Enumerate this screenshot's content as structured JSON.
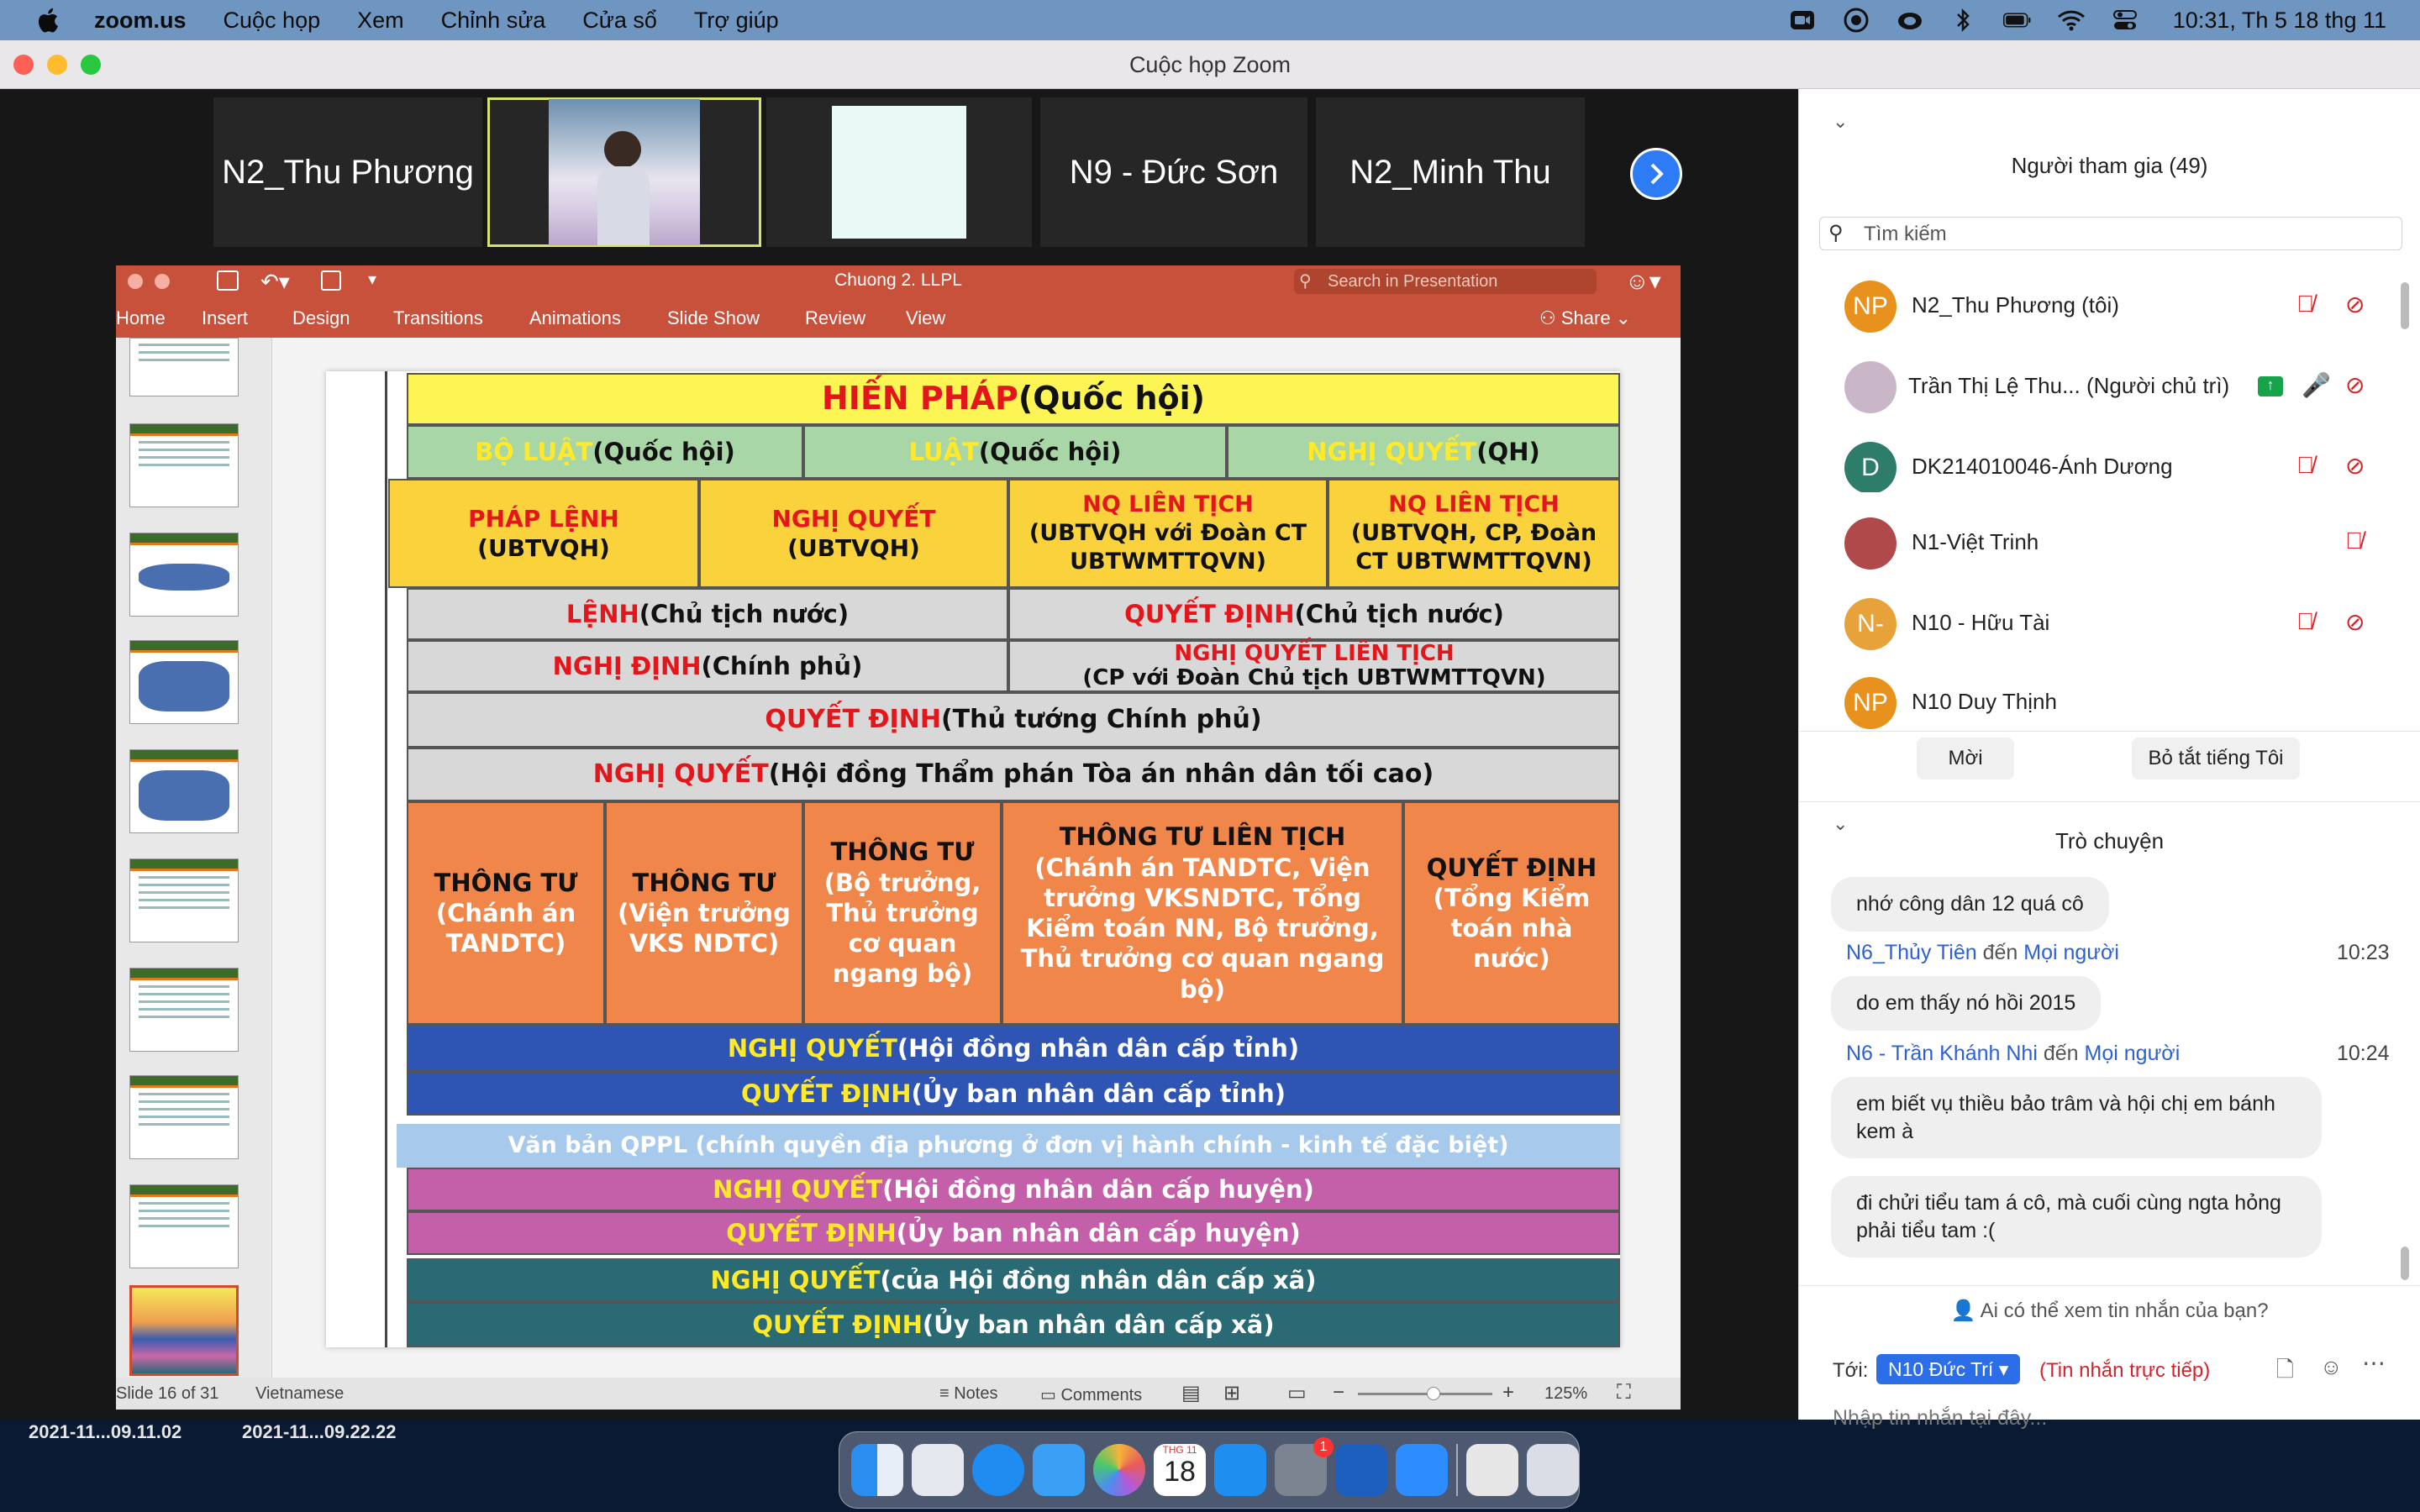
{
  "menubar": {
    "app": "zoom.us",
    "items": [
      "Cuộc họp",
      "Xem",
      "Chỉnh sửa",
      "Cửa sổ",
      "Trợ giúp"
    ],
    "clock": "10:31, Th 5 18 thg 11"
  },
  "window": {
    "title": "Cuộc họp Zoom"
  },
  "videos": [
    "N2_Thu Phương",
    "N9 - Đức Sơn",
    "N2_Minh Thu"
  ],
  "ppt": {
    "title": "Chuong 2. LLPL",
    "search_placeholder": "Search in Presentation",
    "tabs": [
      "Home",
      "Insert",
      "Design",
      "Transitions",
      "Animations",
      "Slide Show",
      "Review",
      "View"
    ],
    "share": "Share",
    "status": {
      "slide": "Slide 16 of 31",
      "lang": "Vietnamese",
      "notes": "Notes",
      "comments": "Comments",
      "zoom": "125%"
    }
  },
  "slide": {
    "hien_phap": [
      "HIẾN PHÁP",
      " (Quốc hội)"
    ],
    "row2": [
      [
        "BỘ LUẬT",
        " (Quốc hội)"
      ],
      [
        "LUẬT",
        " (Quốc hội)"
      ],
      [
        "NGHỊ QUYẾT",
        " (QH)"
      ]
    ],
    "row3": [
      [
        "PHÁP LỆNH",
        "(UBTVQH)"
      ],
      [
        "NGHỊ QUYẾT",
        "(UBTVQH)"
      ],
      [
        "NQ LIÊN TỊCH",
        "(UBTVQH với Đoàn CT UBTWMTTQVN)"
      ],
      [
        "NQ LIÊN TỊCH",
        "(UBTVQH, CP, Đoàn CT UBTWMTTQVN)"
      ]
    ],
    "row4": [
      [
        "LỆNH",
        " (Chủ tịch nước)"
      ],
      [
        "QUYẾT ĐỊNH",
        " (Chủ tịch nước)"
      ]
    ],
    "row5": [
      [
        "NGHỊ ĐỊNH",
        " (Chính phủ)"
      ],
      [
        "NGHỊ QUYẾT LIÊN TỊCH",
        "(CP với Đoàn Chủ tịch UBTWMTTQVN)"
      ]
    ],
    "row6": [
      "QUYẾT ĐỊNH",
      " (Thủ tướng Chính phủ)"
    ],
    "row7": [
      "NGHỊ QUYẾT",
      " (Hội đồng Thẩm phán Tòa án nhân dân tối cao)"
    ],
    "row8": [
      [
        "THÔNG TƯ",
        "(Chánh án TANDTC)"
      ],
      [
        "THÔNG TƯ",
        "(Viện trưởng VKS NDTC)"
      ],
      [
        "THÔNG TƯ",
        "(Bộ trưởng, Thủ trưởng cơ quan ngang bộ)"
      ],
      [
        "THÔNG TƯ LIÊN TỊCH",
        "(Chánh án TANDTC, Viện trưởng VKSNDTC, Tổng Kiểm toán NN, Bộ trưởng, Thủ trưởng cơ quan ngang bộ)"
      ],
      [
        "QUYẾT ĐỊNH",
        "(Tổng Kiểm toán nhà nước)"
      ]
    ],
    "blue1": [
      "NGHỊ QUYẾT",
      " (Hội đồng nhân dân cấp tỉnh)"
    ],
    "blue2": [
      "QUYẾT ĐỊNH",
      " (Ủy ban nhân dân cấp tỉnh)"
    ],
    "lightblue": "Văn bản QPPL (chính quyền địa phương ở đơn vị hành chính - kinh tế đặc biệt)",
    "pink1": [
      "NGHỊ QUYẾT",
      " (Hội đồng nhân dân cấp huyện)"
    ],
    "pink2": [
      "QUYẾT ĐỊNH",
      " (Ủy ban nhân dân cấp huyện)"
    ],
    "teal1": [
      "NGHỊ QUYẾT",
      " (của Hội đồng nhân dân cấp xã)"
    ],
    "teal2": [
      "QUYẾT ĐỊNH",
      " (Ủy ban nhân dân cấp xã)"
    ]
  },
  "participants": {
    "header": "Người tham gia (49)",
    "search_placeholder": "Tìm kiếm",
    "list": [
      {
        "initials": "NP",
        "name": "N2_Thu Phương (tôi)",
        "color": "#e8911c"
      },
      {
        "initials": "",
        "name": "Trần Thị Lệ Thu...  (Người chủ trì)",
        "color": "#c9b7c9"
      },
      {
        "initials": "D",
        "name": "DK214010046-Ánh Dương",
        "color": "#2e7d6b"
      },
      {
        "initials": "",
        "name": "N1-Việt Trinh",
        "color": "#b04a4a"
      },
      {
        "initials": "N-",
        "name": "N10 - Hữu Tài",
        "color": "#e8a23a"
      },
      {
        "initials": "NP",
        "name": "N10 Duy Thịnh",
        "color": "#e8911c"
      }
    ],
    "invite": "Mời",
    "mute_me": "Bỏ tắt tiếng Tôi"
  },
  "chat": {
    "header": "Trò chuyện",
    "messages": [
      {
        "text": "nhớ công dân 12 quá cô"
      },
      {
        "from": "N6_Thủy Tiên",
        "to_word": "đến",
        "to": "Mọi người",
        "time": "10:23",
        "text": "do em thấy nó hồi 2015"
      },
      {
        "from": "N6 - Trần Khánh Nhi",
        "to_word": "đến",
        "to": "Mọi người",
        "time": "10:24",
        "text": "em biết vụ thiều bảo trâm và hội chị em bánh kem à"
      },
      {
        "text": "đi chửi tiểu tam á cô, mà cuối cùng ngta hỏng phải tiểu tam :("
      }
    ],
    "privacy": "Ai có thể xem tin nhắn của bạn?",
    "to_label": "Tới:",
    "recipient": "N10 Đức Trí",
    "direct": "(Tin nhắn trực tiếp)",
    "input_placeholder": "Nhập tin nhắn tại đây..."
  },
  "desktop": {
    "files": [
      "2021-11...09.11.02",
      "2021-11...09.22.22"
    ],
    "calendar_month": "THG 11",
    "calendar_day": "18",
    "badge": "1"
  }
}
